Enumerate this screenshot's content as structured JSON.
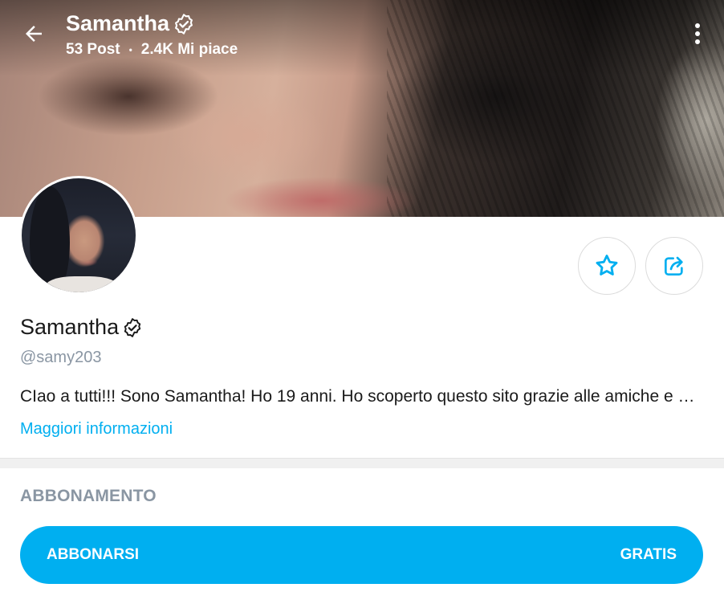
{
  "header": {
    "title": "Samantha",
    "posts": "53 Post",
    "likes": "2.4K Mi piace",
    "separator": "•"
  },
  "profile": {
    "name": "Samantha",
    "handle": "@samy203",
    "bio": "CIao a tutti!!! Sono Samantha! Ho 19 anni. Ho scoperto questo sito grazie alle amiche e ho deciso di provare",
    "more_info": "Maggiori informazioni"
  },
  "subscription": {
    "heading": "ABBONAMENTO",
    "button_label": "ABBONARSI",
    "price": "GRATIS"
  },
  "icons": {
    "back": "arrow-left-icon",
    "verified": "verified-badge-icon",
    "more": "more-vertical-icon",
    "favorite": "star-icon",
    "share": "share-icon"
  },
  "colors": {
    "accent": "#00aff0",
    "muted": "#8a96a3"
  }
}
